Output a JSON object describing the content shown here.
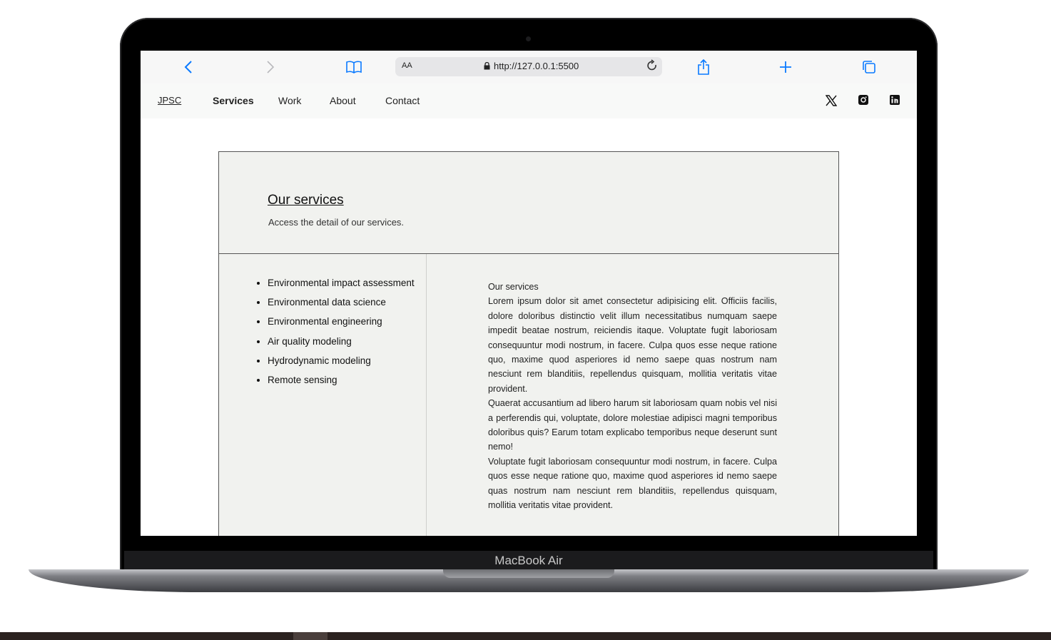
{
  "device": {
    "label": "MacBook Air"
  },
  "browser": {
    "text_size_label": "AA",
    "url": "http://127.0.0.1:5500",
    "icons": [
      "chevron-left-icon",
      "chevron-right-icon",
      "book-icon",
      "lock-icon",
      "reload-icon",
      "share-icon",
      "plus-icon",
      "tabs-icon"
    ]
  },
  "site": {
    "brand": "JPSC",
    "nav": [
      {
        "label": "Services",
        "active": true
      },
      {
        "label": "Work",
        "active": false
      },
      {
        "label": "About",
        "active": false
      },
      {
        "label": "Contact",
        "active": false
      }
    ],
    "social_icons": [
      "x-icon",
      "instagram-icon",
      "linkedin-icon"
    ]
  },
  "services": {
    "title": "Our services",
    "subtitle": "Access the detail of our services.",
    "items": [
      "Environmental impact assessment",
      "Environmental data science",
      "Environmental engineering",
      "Air quality modeling",
      "Hydrodynamic modeling",
      "Remote sensing"
    ],
    "detail_heading": "Our services",
    "paragraphs": [
      "Lorem ipsum dolor sit amet consectetur adipisicing elit. Officiis facilis, dolore doloribus distinctio velit illum necessitatibus numquam saepe impedit beatae nostrum, reiciendis itaque. Voluptate fugit laboriosam consequuntur modi nostrum, in facere. Culpa quos esse neque ratione quo, maxime quod asperiores id nemo saepe quas nostrum nam nesciunt rem blanditiis, repellendus quisquam, mollitia veritatis vitae provident.",
      "Quaerat accusantium ad libero harum sit laboriosam quam nobis vel nisi a perferendis qui, voluptate, dolore molestiae adipisci magni temporibus doloribus quis? Earum totam explicabo temporibus neque deserunt sunt nemo!",
      "Voluptate fugit laboriosam consequuntur modi nostrum, in facere. Culpa quos esse neque ratione quo, maxime quod asperiores id nemo saepe quas nostrum nam nesciunt rem blanditiis, repellendus quisquam, mollitia veritatis vitae provident."
    ]
  },
  "colors": {
    "accent": "#0a7aff",
    "card_bg": "#f1f2ef"
  }
}
